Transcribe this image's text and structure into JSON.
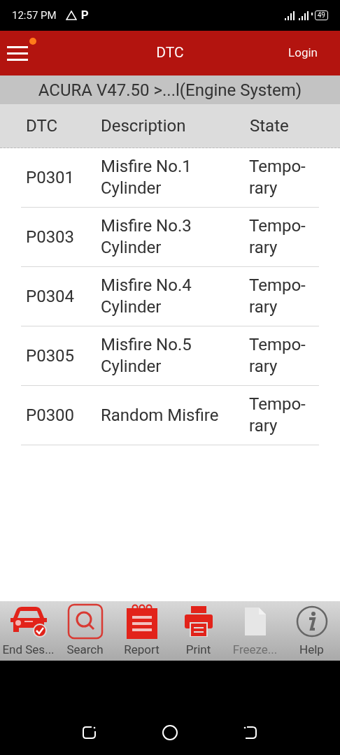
{
  "status_bar": {
    "time": "12:57 PM",
    "notification_glyph": "P",
    "battery": "49"
  },
  "header": {
    "title": "DTC",
    "login": "Login",
    "menu_badge": true
  },
  "breadcrumb": "ACURA V47.50 >...l(Engine System)",
  "table": {
    "columns": [
      "DTC",
      "Description",
      "State"
    ],
    "rows": [
      {
        "code": "P0301",
        "description": "Misfire No.1 Cylinder",
        "state": "Tempo-rary"
      },
      {
        "code": "P0303",
        "description": "Misfire No.3 Cylinder",
        "state": "Tempo-rary"
      },
      {
        "code": "P0304",
        "description": "Misfire No.4 Cylinder",
        "state": "Tempo-rary"
      },
      {
        "code": "P0305",
        "description": "Misfire No.5 Cylinder",
        "state": "Tempo-rary"
      },
      {
        "code": "P0300",
        "description": "Random Misfire",
        "state": "Tempo-rary"
      }
    ]
  },
  "toolbar": [
    {
      "kind": "car",
      "label": "End Ses...",
      "disabled": false
    },
    {
      "kind": "search",
      "label": "Search",
      "disabled": false
    },
    {
      "kind": "report",
      "label": "Report",
      "disabled": false
    },
    {
      "kind": "print",
      "label": "Print",
      "disabled": false
    },
    {
      "kind": "document",
      "label": "Freeze...",
      "disabled": true
    },
    {
      "kind": "info",
      "label": "Help",
      "disabled": false
    }
  ]
}
